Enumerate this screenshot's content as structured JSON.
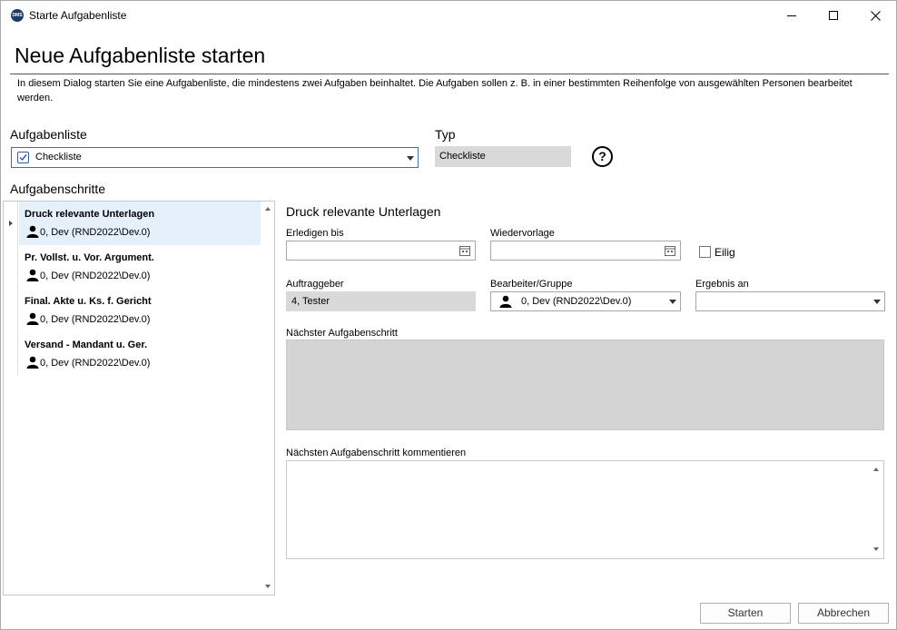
{
  "window": {
    "title": "Starte Aufgabenliste",
    "app_icon_text": "DMS"
  },
  "heading": "Neue Aufgabenliste starten",
  "description": "In diesem Dialog starten Sie eine Aufgabenliste, die mindestens zwei Aufgaben beinhaltet. Die Aufgaben sollen z. B. in einer bestimmten Reihenfolge von ausgewählten Personen bearbeitet werden.",
  "aufgabenliste": {
    "label": "Aufgabenliste",
    "value": "Checkliste"
  },
  "typ": {
    "label": "Typ",
    "value": "Checkliste",
    "help": "?"
  },
  "steps": {
    "label": "Aufgabenschritte",
    "items": [
      {
        "title": "Druck relevante Unterlagen",
        "user": "0, Dev (RND2022\\Dev.0)"
      },
      {
        "title": "Pr. Vollst. u. Vor. Argument.",
        "user": "0, Dev (RND2022\\Dev.0)"
      },
      {
        "title": "Final. Akte u. Ks. f. Gericht",
        "user": "0, Dev (RND2022\\Dev.0)"
      },
      {
        "title": "Versand - Mandant u. Ger.",
        "user": "0, Dev (RND2022\\Dev.0)"
      }
    ]
  },
  "detail": {
    "title": "Druck relevante Unterlagen",
    "erledigen_bis": {
      "label": "Erledigen bis",
      "value": ""
    },
    "wiedervorlage": {
      "label": "Wiedervorlage",
      "value": ""
    },
    "eilig": {
      "label": "Eilig",
      "checked": false
    },
    "auftraggeber": {
      "label": "Auftraggeber",
      "value": "4, Tester"
    },
    "bearbeiter": {
      "label": "Bearbeiter/Gruppe",
      "value": "0, Dev (RND2022\\Dev.0)"
    },
    "ergebnis": {
      "label": "Ergebnis an",
      "value": ""
    },
    "naechster": {
      "label": "Nächster Aufgabenschritt"
    },
    "kommentar": {
      "label": "Nächsten Aufgabenschritt kommentieren"
    }
  },
  "buttons": {
    "start": "Starten",
    "cancel": "Abbrechen"
  },
  "colors": {
    "accent": "#3c6eb4",
    "selected_row": "#e5f0fb",
    "readonly_bg": "#d9d9d9"
  }
}
